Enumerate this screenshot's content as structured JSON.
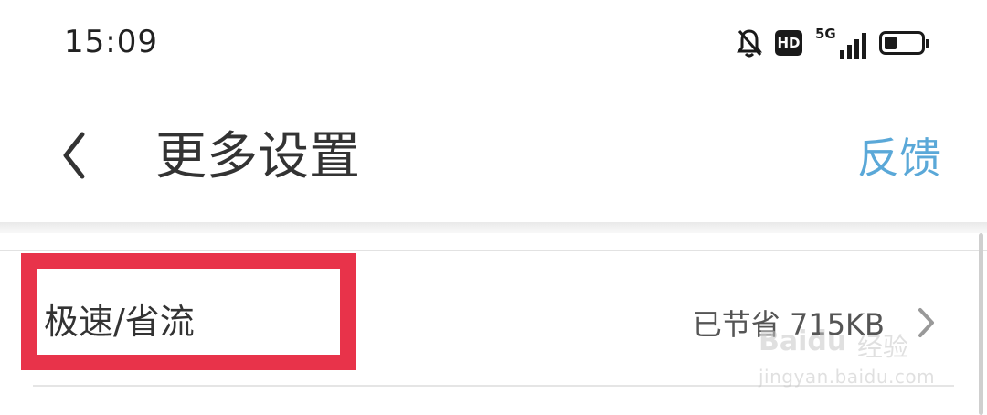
{
  "status_bar": {
    "time": "15:09",
    "icons": [
      "bell-off-icon",
      "hd-icon",
      "signal-5g-icon",
      "battery-icon"
    ],
    "hd_label": "HD",
    "network_label": "5G",
    "battery_level": 0.35
  },
  "header": {
    "back_icon": "chevron-left-icon",
    "title": "更多设置",
    "feedback_label": "反馈"
  },
  "settings": {
    "rows": [
      {
        "label": "极速/省流",
        "value": "已节省 715KB",
        "icon": "chevron-right-icon"
      }
    ]
  },
  "highlight": {
    "color": "#e8334a",
    "target": "极速/省流"
  },
  "watermark": {
    "logo_text": "Baidu",
    "text": "经验",
    "url": "jingyan.baidu.com"
  },
  "colors": {
    "accent": "#5aa8d8",
    "highlight": "#e8334a",
    "text": "#333333"
  }
}
